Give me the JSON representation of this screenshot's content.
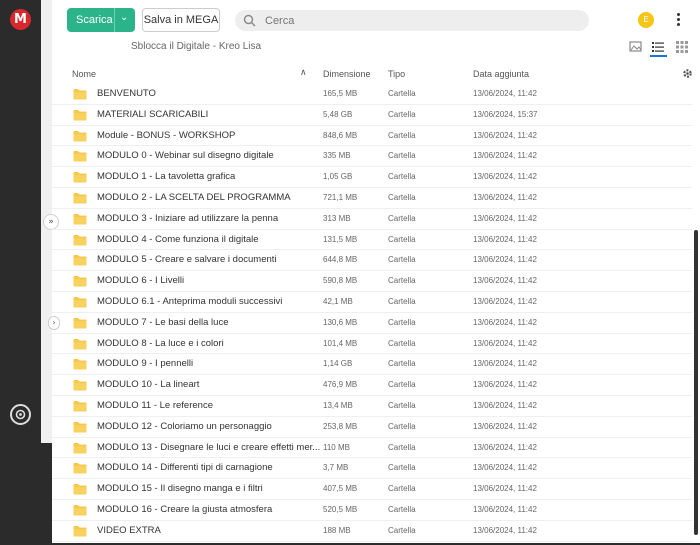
{
  "rail": {
    "logo": "M"
  },
  "toolbar": {
    "download_label": "Scarica",
    "save_label": "Salva in MEGA",
    "search_placeholder": "Cerca",
    "avatar_initial": "E"
  },
  "breadcrumb": "Sblocca il Digitale - Kreo Lisa",
  "columns": {
    "name": "Nome",
    "size": "Dimensione",
    "type": "Tipo",
    "date": "Data aggiunta"
  },
  "rows": [
    {
      "name": "BENVENUTO",
      "size": "165,5 MB",
      "type": "Cartella",
      "date": "13/06/2024, 11:42"
    },
    {
      "name": "MATERIALI SCARICABILI",
      "size": "5,48 GB",
      "type": "Cartella",
      "date": "13/06/2024, 15:37"
    },
    {
      "name": "Module - BONUS - WORKSHOP",
      "size": "848,6 MB",
      "type": "Cartella",
      "date": "13/06/2024, 11:42"
    },
    {
      "name": "MODULO 0 - Webinar sul disegno digitale",
      "size": "335 MB",
      "type": "Cartella",
      "date": "13/06/2024, 11:42"
    },
    {
      "name": "MODULO 1 - La tavoletta grafica",
      "size": "1,05 GB",
      "type": "Cartella",
      "date": "13/06/2024, 11:42"
    },
    {
      "name": "MODULO 2 - LA SCELTA DEL PROGRAMMA",
      "size": "721,1 MB",
      "type": "Cartella",
      "date": "13/06/2024, 11:42"
    },
    {
      "name": "MODULO 3 - Iniziare ad utilizzare la penna",
      "size": "313 MB",
      "type": "Cartella",
      "date": "13/06/2024, 11:42"
    },
    {
      "name": "MODULO 4 - Come funziona il digitale",
      "size": "131,5 MB",
      "type": "Cartella",
      "date": "13/06/2024, 11:42"
    },
    {
      "name": "MODULO 5 - Creare e salvare i documenti",
      "size": "644,8 MB",
      "type": "Cartella",
      "date": "13/06/2024, 11:42"
    },
    {
      "name": "MODULO 6 - I Livelli",
      "size": "590,8 MB",
      "type": "Cartella",
      "date": "13/06/2024, 11:42"
    },
    {
      "name": "MODULO 6.1 - Anteprima moduli successivi",
      "size": "42,1 MB",
      "type": "Cartella",
      "date": "13/06/2024, 11:42"
    },
    {
      "name": "MODULO 7 - Le basi della luce",
      "size": "130,6 MB",
      "type": "Cartella",
      "date": "13/06/2024, 11:42"
    },
    {
      "name": "MODULO 8 - La luce e i colori",
      "size": "101,4 MB",
      "type": "Cartella",
      "date": "13/06/2024, 11:42"
    },
    {
      "name": "MODULO 9 - I pennelli",
      "size": "1,14 GB",
      "type": "Cartella",
      "date": "13/06/2024, 11:42"
    },
    {
      "name": "MODULO 10 - La lineart",
      "size": "476,9 MB",
      "type": "Cartella",
      "date": "13/06/2024, 11:42"
    },
    {
      "name": "MODULO 11 - Le reference",
      "size": "13,4 MB",
      "type": "Cartella",
      "date": "13/06/2024, 11:42"
    },
    {
      "name": "MODULO 12 - Coloriamo un personaggio",
      "size": "253,8 MB",
      "type": "Cartella",
      "date": "13/06/2024, 11:42"
    },
    {
      "name": "MODULO 13 - Disegnare le luci e creare effetti mer...",
      "size": "110 MB",
      "type": "Cartella",
      "date": "13/06/2024, 11:42"
    },
    {
      "name": "MODULO 14 - Differenti tipi di carnagione",
      "size": "3,7 MB",
      "type": "Cartella",
      "date": "13/06/2024, 11:42"
    },
    {
      "name": "MODULO 15 - Il disegno manga e i filtri",
      "size": "407,5 MB",
      "type": "Cartella",
      "date": "13/06/2024, 11:42"
    },
    {
      "name": "MODULO 16 - Creare la giusta atmosfera",
      "size": "520,5 MB",
      "type": "Cartella",
      "date": "13/06/2024, 11:42"
    },
    {
      "name": "VIDEO EXTRA",
      "size": "188 MB",
      "type": "Cartella",
      "date": "13/06/2024, 11:42"
    }
  ],
  "colors": {
    "accent_green": "#2bb48a",
    "brand_red": "#d9272e",
    "folder_yellow": "#f5c84c",
    "avatar_yellow": "#f5c518"
  }
}
